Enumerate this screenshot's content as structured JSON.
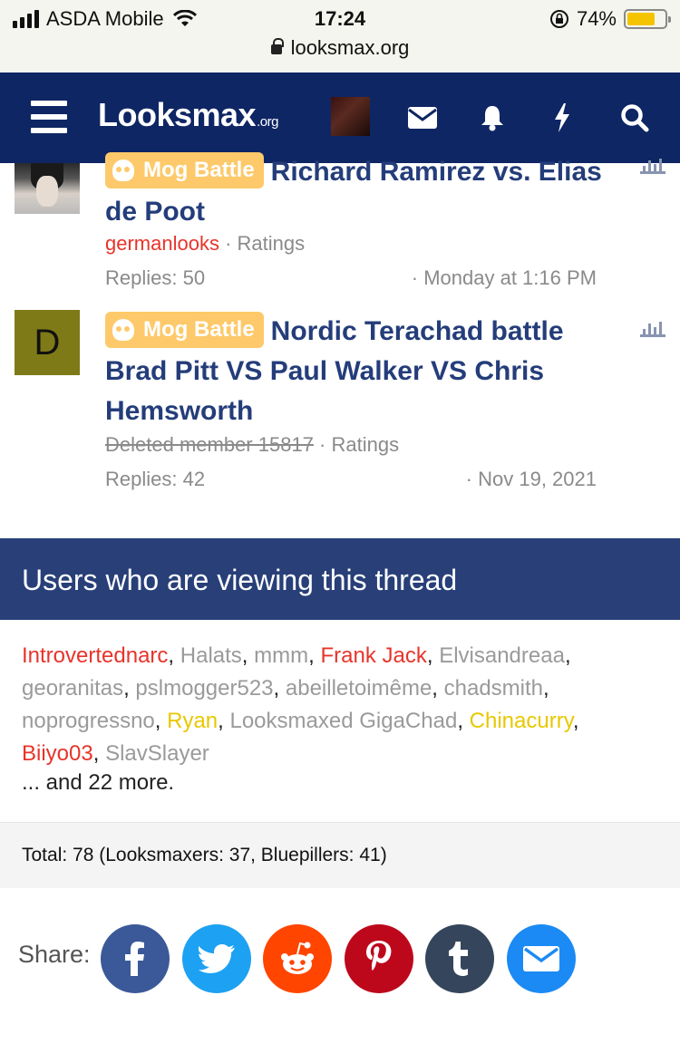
{
  "status_bar": {
    "carrier": "ASDA Mobile",
    "time": "17:24",
    "battery_percent": "74%",
    "battery_level": 0.74,
    "url": "looksmax.org"
  },
  "header": {
    "logo_text": "Looksmax",
    "logo_tld": ".org",
    "icons": [
      "menu-icon",
      "user-avatar",
      "envelope-icon",
      "bell-icon",
      "bolt-icon",
      "search-icon"
    ]
  },
  "threads": [
    {
      "prefix": "Mog Battle",
      "title": "Richard Ramirez vs. Elias de Poot",
      "author": "germanlooks",
      "forum": "Ratings",
      "replies": "Replies: 50",
      "date": "Monday at 1:16 PM"
    },
    {
      "avatar_letter": "D",
      "prefix": "Mog Battle",
      "title": "Nordic Terachad battle Brad Pitt VS Paul Walker VS Chris Hemsworth",
      "author": "Deleted member 15817",
      "forum": "Ratings",
      "replies": "Replies: 42",
      "date": "Nov 19, 2021"
    }
  ],
  "viewers": {
    "heading": "Users who are viewing this thread",
    "users": [
      {
        "name": "Introvertednarc",
        "color": "red"
      },
      {
        "name": "Halats",
        "color": "gray"
      },
      {
        "name": "mmm",
        "color": "gray"
      },
      {
        "name": "Frank Jack",
        "color": "red"
      },
      {
        "name": "Elvisandreaa",
        "color": "gray"
      },
      {
        "name": "georanitas",
        "color": "gray"
      },
      {
        "name": "pslmogger523",
        "color": "gray"
      },
      {
        "name": "abeilletoimême",
        "color": "gray"
      },
      {
        "name": "chadsmith",
        "color": "gray"
      },
      {
        "name": "noprogressno",
        "color": "gray"
      },
      {
        "name": "Ryan",
        "color": "yellow"
      },
      {
        "name": "Looksmaxed GigaChad",
        "color": "gray"
      },
      {
        "name": "Chinacurry",
        "color": "yellow"
      },
      {
        "name": "Biiyo03",
        "color": "red"
      },
      {
        "name": "SlavSlayer",
        "color": "gray"
      }
    ],
    "more": "... and 22 more.",
    "total": "Total: 78 (Looksmaxers: 37, Bluepillers: 41)"
  },
  "share": {
    "label": "Share:",
    "buttons": [
      {
        "network": "facebook",
        "color": "#3b5998"
      },
      {
        "network": "twitter",
        "color": "#1da1f2"
      },
      {
        "network": "reddit",
        "color": "#ff4500"
      },
      {
        "network": "pinterest",
        "color": "#bd081c"
      },
      {
        "network": "tumblr",
        "color": "#35465c"
      },
      {
        "network": "email",
        "color": "#1b8af4"
      }
    ]
  },
  "colors": {
    "header_bg": "#0f2664",
    "section_head_bg": "#283f78",
    "title_color": "#243d7a",
    "prefix_bg": "#fdc96a",
    "username_red": "#e8342a",
    "username_yellow": "#e8c800"
  }
}
